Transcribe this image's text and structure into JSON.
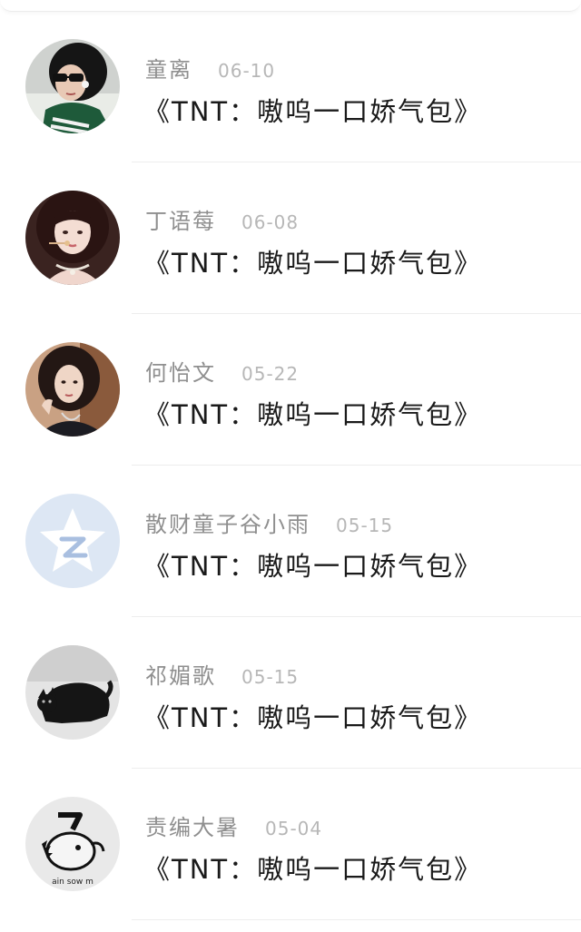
{
  "comments": [
    {
      "name": "童离",
      "date": "06-10",
      "title": "《TNT：嗷呜一口娇气包》",
      "avatar_icon": "girl-sunglasses-avatar"
    },
    {
      "name": "丁语莓",
      "date": "06-08",
      "title": "《TNT：嗷呜一口娇气包》",
      "avatar_icon": "girl-headset-avatar"
    },
    {
      "name": "何怡文",
      "date": "05-22",
      "title": "《TNT：嗷呜一口娇气包》",
      "avatar_icon": "girl-dark-hair-avatar"
    },
    {
      "name": "散财童子谷小雨",
      "date": "05-15",
      "title": "《TNT：嗷呜一口娇气包》",
      "avatar_icon": "default-star-avatar"
    },
    {
      "name": "祁媚歌",
      "date": "05-15",
      "title": "《TNT：嗷呜一口娇气包》",
      "avatar_icon": "black-cat-avatar"
    },
    {
      "name": "责编大暑",
      "date": "05-04",
      "title": "《TNT：嗷呜一口娇气包》",
      "avatar_icon": "chainsaw-dog-avatar",
      "avatar_caption": "ain sow m"
    }
  ]
}
